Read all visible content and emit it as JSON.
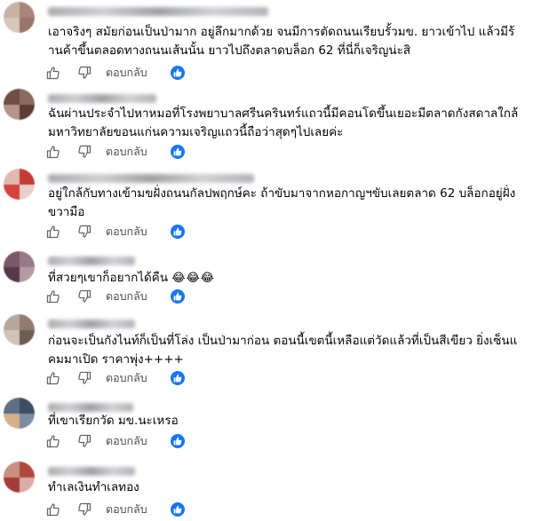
{
  "ui": {
    "reply_label": "ตอบกลับ"
  },
  "colors": {
    "reaction_badge": "#1877f2",
    "icon_gray": "#65676b",
    "text": "#050505"
  },
  "comments": [
    {
      "text": "เอาจริงๆ สมัยก่อนเป็นป่ามาก อยู่ลึกมากด้วย จนมีการตัดถนนเรียบรั้วมข. ยาวเข้าไป แล้วมีร้านค้าขึ้นตลอดทางถนนเส้นนั้น ยาวไปถึงตลาดบล็อก 62 ที่นี่ก็เจริญน่ะสิ"
    },
    {
      "text": "ฉันผ่านประจำไปหาหมอที่โรงพยาบาลศรีนครินทร์แถวนี้มีคอนโดขึ้นเยอะมีตลาดกังสดาลใกล้มหาวิทยาลัยขอนแก่นความเจริญแถวนี้ถือว่าสุดๆไปเลยค่ะ"
    },
    {
      "text": "อยู่ใกล้กับทางเข้ามขฝั่งถนนกัลปพฤกษ์คะ ถ้าขับมาจากหอกาญฯขับเลยตลาด 62 บล็อกอยู่ฝั่งขวามือ"
    },
    {
      "text": "ที่สวยๆเขาก็อยากได้คืน",
      "emoji": "😂😂😂"
    },
    {
      "text": "ก่อนจะเป็นกังไนท์ก็เป็นที่โล่ง เป็นป่ามาก่อน ตอนนี้เขตนี้เหลือแต่วัดแล้วที่เป็นสีเขียว ยิ่งเซ็นแคมมาเปิด ราคาพุ่ง++++"
    },
    {
      "text": "ที่เขาเรียกวัด มข.นะเหรอ"
    },
    {
      "text": "ทำเลเงินทำเลทอง"
    }
  ]
}
